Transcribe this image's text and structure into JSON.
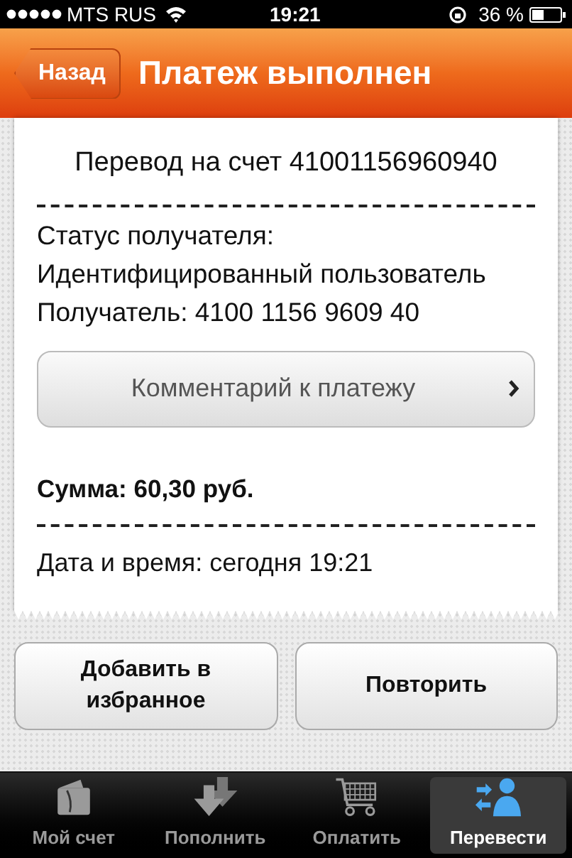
{
  "status_bar": {
    "carrier": "MTS RUS",
    "time": "19:21",
    "battery": "36 %"
  },
  "nav_bar": {
    "back": "Назад",
    "title": "Платеж выполнен"
  },
  "receipt": {
    "title": "Перевод на счет 41001156960940",
    "details": [
      "Статус получателя:",
      "Идентифицированный пользователь",
      "Получатель: 4100 1156 9609 40"
    ],
    "comment_button": "Комментарий к платежу",
    "sum": "Сумма: 60,30 руб.",
    "datetime": "Дата и время: сегодня 19:21"
  },
  "actions": [
    "Добавить в избранное",
    "Повторить"
  ],
  "tabs": [
    {
      "label": "Мой счет",
      "selected": false
    },
    {
      "label": "Пополнить",
      "selected": false
    },
    {
      "label": "Оплатить",
      "selected": false
    },
    {
      "label": "Перевести",
      "selected": true
    }
  ]
}
